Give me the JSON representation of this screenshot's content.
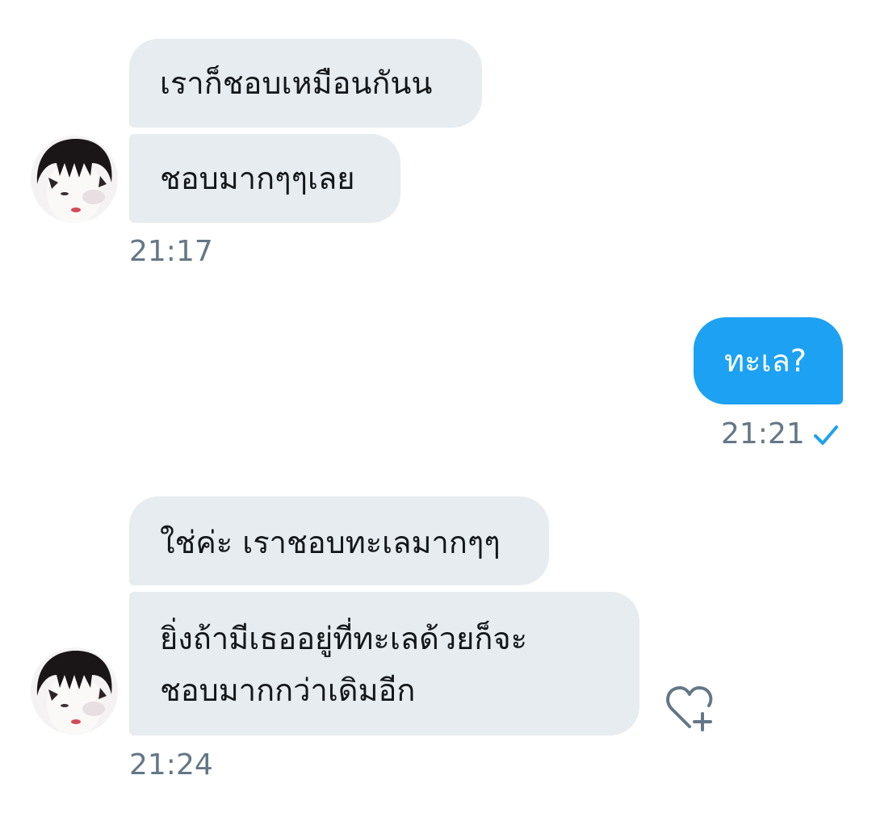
{
  "conversation": {
    "group1": {
      "messages": [
        "เราก็ชอบเหมือนกันน",
        "ชอบมากๆๆเลย"
      ],
      "time": "21:17"
    },
    "group2": {
      "message": "ทะเล?",
      "time": "21:21",
      "status_icon": "check-icon"
    },
    "group3": {
      "messages": [
        "ใช่ค่ะ เราชอบทะเลมากๆๆ",
        "ยิ่งถ้ามีเธออยู่ที่ทะเลด้วยก็จะ",
        "ชอบมากกว่าเดิมอีก"
      ],
      "time": "21:24"
    }
  },
  "colors": {
    "incoming_bubble": "#e6ecf0",
    "outgoing_bubble": "#1da1f2",
    "timestamp": "#657786",
    "read_check": "#1da1f2"
  },
  "icons": {
    "like": "heart-plus-icon",
    "avatar": "user-avatar"
  }
}
